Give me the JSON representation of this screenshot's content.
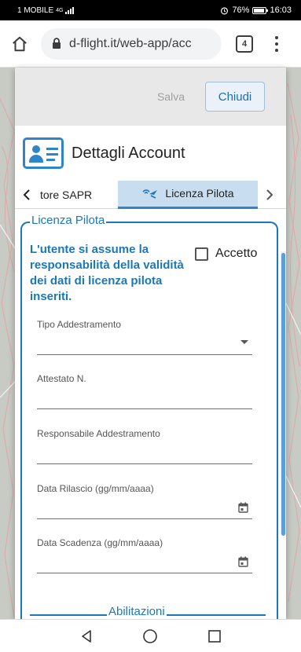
{
  "status_bar": {
    "carrier": "1 MOBILE",
    "network": "4G",
    "battery": "76%",
    "time": "16:03"
  },
  "browser": {
    "url": "d-flight.it/web-app/acc",
    "tab_count": "4"
  },
  "dialog": {
    "save_label": "Salva",
    "close_label": "Chiudi",
    "title": "Dettagli Account",
    "tabs": {
      "prev_label": "tore SAPR",
      "active_label": "Licenza Pilota"
    },
    "fieldset_legend": "Licenza Pilota",
    "notice": "L'utente si assume la responsabilità della validità dei dati di licenza pilota inseriti.",
    "accept_label": "Accetto",
    "accept_checked": false,
    "fields": [
      {
        "label": "Tipo Addestramento",
        "value": "",
        "type": "select"
      },
      {
        "label": "Attestato N.",
        "value": "",
        "type": "text"
      },
      {
        "label": "Responsabile Addestramento",
        "value": "",
        "type": "text"
      },
      {
        "label": "Data Rilascio (gg/mm/aaaa)",
        "value": "",
        "type": "date"
      },
      {
        "label": "Data Scadenza (gg/mm/aaaa)",
        "value": "",
        "type": "date"
      }
    ],
    "sub_legend": "Abilitazioni"
  },
  "colors": {
    "accent": "#1a78b8",
    "active_tab_bg": "#c8def0",
    "actions_bg": "#e8e8e8"
  }
}
